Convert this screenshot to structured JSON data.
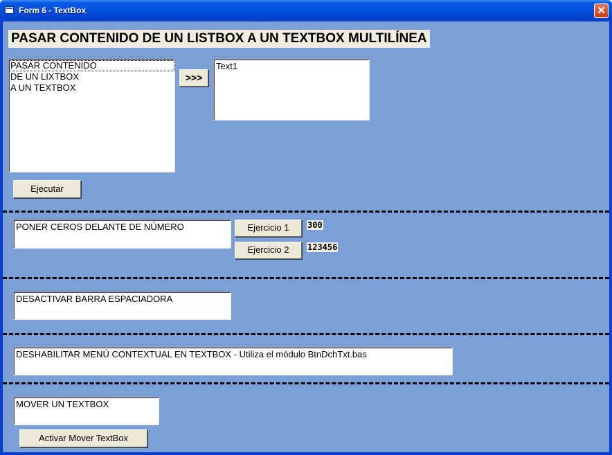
{
  "window": {
    "title": "Form 6 - TextBox",
    "close_label": "✕"
  },
  "heading": "PASAR CONTENIDO DE UN LISTBOX A UN TEXTBOX MULTILÍNEA",
  "listbox": {
    "items": [
      "PASAR CONTENIDO",
      "DE UN LIXTBOX",
      "A UN TEXTBOX"
    ]
  },
  "transfer_button": ">>>",
  "text1": "Text1",
  "ejecutar_button": "Ejecutar",
  "ceros": {
    "textbox": "PONER CEROS DELANTE DE NÚMERO",
    "ejercicio1_button": "Ejercicio 1",
    "ejercicio1_value": "300",
    "ejercicio2_button": "Ejercicio 2",
    "ejercicio2_value": "123456"
  },
  "espaciadora_textbox": "DESACTIVAR BARRA ESPACIADORA",
  "menu_textbox": "DESHABILITAR MENÚ CONTEXTUAL EN TEXTBOX - Utiliza el módulo BtnDchTxt.bas",
  "mover": {
    "textbox": "MOVER UN TEXTBOX",
    "button": "Activar Mover TextBox"
  }
}
